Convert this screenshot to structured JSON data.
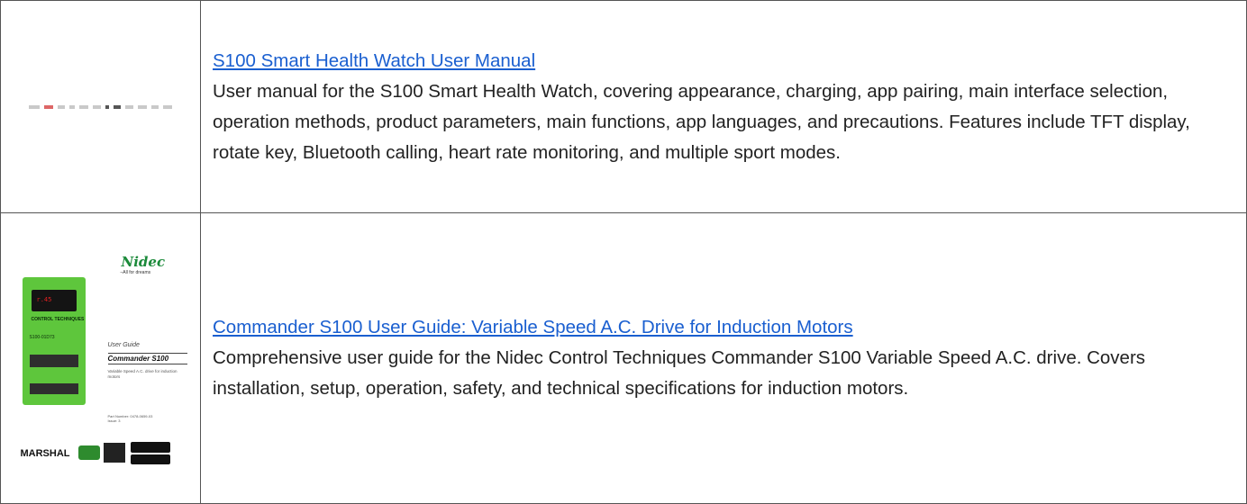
{
  "results": [
    {
      "title": "S100 Smart Health Watch User Manual",
      "description": "User manual for the S100 Smart Health Watch, covering appearance, charging, app pairing, main interface selection, operation methods, product parameters, main functions, app languages, and precautions. Features include TFT display, rotate key, Bluetooth calling, heart rate monitoring, and multiple sport modes.",
      "thumbnail_icon": "manual-strip-thumbnail"
    },
    {
      "title": "Commander S100 User Guide: Variable Speed A.C. Drive for Induction Motors",
      "description": "Comprehensive user guide for the Nidec Control Techniques Commander S100 Variable Speed A.C. drive. Covers installation, setup, operation, safety, and technical specifications for induction motors.",
      "thumbnail": {
        "logo": "Nidec",
        "tagline": "–All for dreams",
        "drive_readout": "r.45",
        "drive_brand": "CONTROL TECHNIQUES",
        "drive_model": "S100-01D73",
        "guide_label": "User Guide",
        "guide_title": "Commander S100",
        "guide_subtitle": "Variable Speed A.C. drive for induction motors",
        "part_number": "Part Number: 0478-0659-03",
        "issue": "Issue: 3",
        "footer_brand": "MARSHAL"
      }
    }
  ],
  "colors": {
    "link": "#1a5fd0",
    "border": "#555555",
    "drive_green": "#5ec63c",
    "logo_green": "#1b8a3a"
  }
}
